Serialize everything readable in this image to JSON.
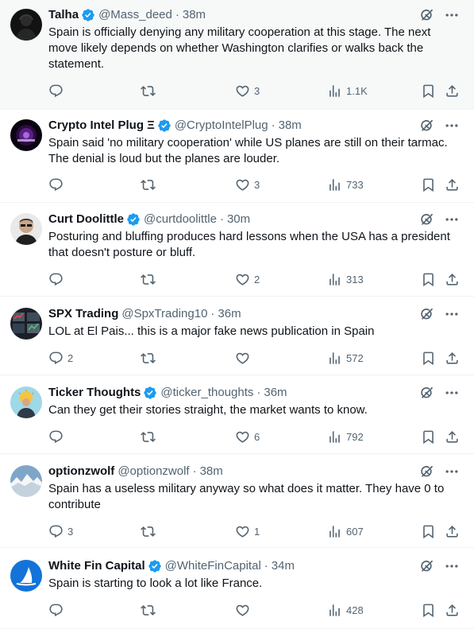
{
  "accent_color": "#1d9bf0",
  "text_color": "#0f1419",
  "secondary_color": "#536471",
  "icons": {
    "verified": "verified-badge-icon",
    "grok": "grok-icon",
    "more": "more-icon",
    "reply": "reply-icon",
    "retweet": "retweet-icon",
    "like": "like-icon",
    "views": "views-icon",
    "bookmark": "bookmark-icon",
    "share": "share-icon"
  },
  "tweets": [
    {
      "name": "Talha",
      "verified": true,
      "handle": "@Mass_deed",
      "time": "38m",
      "text": "Spain is officially denying any military cooperation at this stage. The next move likely depends on whether Washington clarifies or walks back the statement.",
      "replies": "",
      "retweets": "",
      "likes": "3",
      "views": "1.1K"
    },
    {
      "name": "Crypto Intel Plug Ξ",
      "verified": true,
      "handle": "@CryptoIntelPlug",
      "time": "38m",
      "text": "Spain said 'no military cooperation' while US planes are still on their tarmac. The denial is loud but the planes are louder.",
      "replies": "",
      "retweets": "",
      "likes": "3",
      "views": "733"
    },
    {
      "name": "Curt Doolittle",
      "verified": true,
      "handle": "@curtdoolittle",
      "time": "30m",
      "text": "Posturing and bluffing produces hard lessons when the USA has a president that doesn't posture or bluff.",
      "replies": "",
      "retweets": "",
      "likes": "2",
      "views": "313"
    },
    {
      "name": "SPX Trading",
      "verified": false,
      "handle": "@SpxTrading10",
      "time": "36m",
      "text": "LOL at El Pais... this is a major fake news publication in Spain",
      "replies": "2",
      "retweets": "",
      "likes": "",
      "views": "572"
    },
    {
      "name": "Ticker Thoughts",
      "verified": true,
      "handle": "@ticker_thoughts",
      "time": "36m",
      "text": "Can they get their stories straight, the market wants to know.",
      "replies": "",
      "retweets": "",
      "likes": "6",
      "views": "792"
    },
    {
      "name": "optionzwolf",
      "verified": false,
      "handle": "@optionzwolf",
      "time": "38m",
      "text": "Spain has a useless military anyway so what does it matter. They have 0 to contribute",
      "replies": "3",
      "retweets": "",
      "likes": "1",
      "views": "607"
    },
    {
      "name": "White Fin Capital",
      "verified": true,
      "handle": "@WhiteFinCapital",
      "time": "34m",
      "text": "Spain is starting to look a lot like France.",
      "replies": "",
      "retweets": "",
      "likes": "",
      "views": "428"
    }
  ]
}
